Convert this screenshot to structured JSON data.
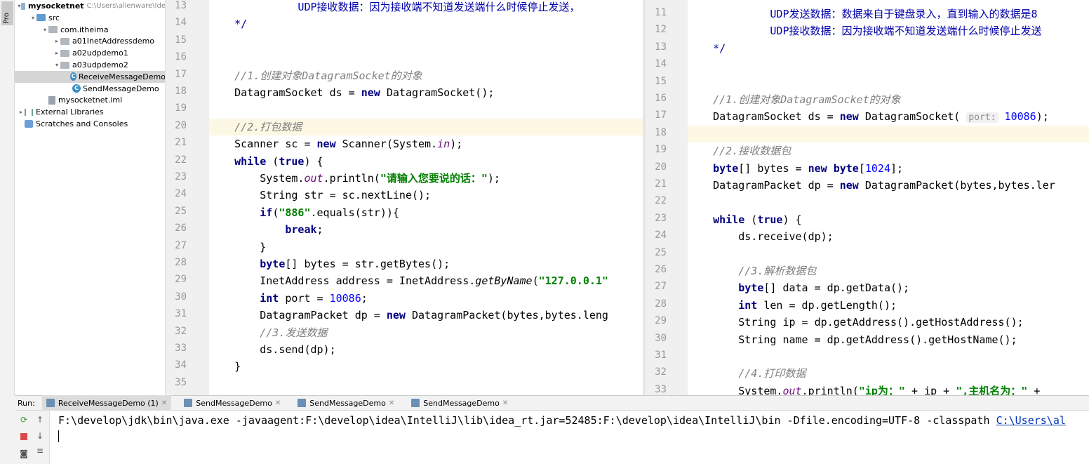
{
  "sidebar": {
    "project_tab": "Pro"
  },
  "project_tree": [
    {
      "label": "mysocketnet",
      "path": "C:\\Users\\alienware\\Ide",
      "type": "module",
      "depth": 0,
      "expanded": true
    },
    {
      "label": "src",
      "type": "src-folder",
      "depth": 1,
      "expanded": true
    },
    {
      "label": "com.itheima",
      "type": "package",
      "depth": 2,
      "expanded": true
    },
    {
      "label": "a01InetAddressdemo",
      "type": "package",
      "depth": 3,
      "expanded": false
    },
    {
      "label": "a02udpdemo1",
      "type": "package",
      "depth": 3,
      "expanded": false
    },
    {
      "label": "a03udpdemo2",
      "type": "package",
      "depth": 3,
      "expanded": true
    },
    {
      "label": "ReceiveMessageDemo",
      "type": "class",
      "depth": 4,
      "selected": true
    },
    {
      "label": "SendMessageDemo",
      "type": "class",
      "depth": 4
    },
    {
      "label": "mysocketnet.iml",
      "type": "iml",
      "depth": 2
    },
    {
      "label": "External Libraries",
      "type": "libs",
      "depth": 0,
      "expanded": false
    },
    {
      "label": "Scratches and Consoles",
      "type": "scratches",
      "depth": 0
    }
  ],
  "editor_left": {
    "lines": [
      {
        "n": "13",
        "code": "              UDP接收数据：因为接收端不知道发送端什么时候停止发送，",
        "style": "doc"
      },
      {
        "n": "14",
        "code": "    */",
        "style": "doc"
      },
      {
        "n": "15",
        "code": ""
      },
      {
        "n": "16",
        "code": ""
      },
      {
        "n": "17",
        "code": "    //1.创建对象DatagramSocket的对象",
        "style": "cm"
      },
      {
        "n": "18",
        "code": "    DatagramSocket ds = new DatagramSocket();"
      },
      {
        "n": "19",
        "code": ""
      },
      {
        "n": "20",
        "code": "    //2.打包数据",
        "style": "cm",
        "highlight": true
      },
      {
        "n": "21",
        "code": "    Scanner sc = new Scanner(System.in);"
      },
      {
        "n": "22",
        "code": "    while (true) {"
      },
      {
        "n": "23",
        "code": "        System.out.println(\"请输入您要说的话：\");"
      },
      {
        "n": "24",
        "code": "        String str = sc.nextLine();"
      },
      {
        "n": "25",
        "code": "        if(\"886\".equals(str)){"
      },
      {
        "n": "26",
        "code": "            break;"
      },
      {
        "n": "27",
        "code": "        }"
      },
      {
        "n": "28",
        "code": "        byte[] bytes = str.getBytes();"
      },
      {
        "n": "29",
        "code": "        InetAddress address = InetAddress.getByName(\"127.0.0.1\""
      },
      {
        "n": "30",
        "code": "        int port = 10086;"
      },
      {
        "n": "31",
        "code": "        DatagramPacket dp = new DatagramPacket(bytes,bytes.leng"
      },
      {
        "n": "32",
        "code": "        //3.发送数据",
        "style": "cm"
      },
      {
        "n": "33",
        "code": "        ds.send(dp);"
      },
      {
        "n": "34",
        "code": "    }"
      },
      {
        "n": "35",
        "code": ""
      }
    ]
  },
  "editor_right": {
    "lines": [
      {
        "n": "11",
        "code": "             UDP发送数据：数据来自于键盘录入，直到输入的数据是8",
        "style": "doc"
      },
      {
        "n": "12",
        "code": "             UDP接收数据：因为接收端不知道发送端什么时候停止发送",
        "style": "doc"
      },
      {
        "n": "13",
        "code": "    */",
        "style": "doc"
      },
      {
        "n": "14",
        "code": ""
      },
      {
        "n": "15",
        "code": ""
      },
      {
        "n": "16",
        "code": "    //1.创建对象DatagramSocket的对象",
        "style": "cm"
      },
      {
        "n": "17",
        "code": "    DatagramSocket ds = new DatagramSocket( port: 10086);"
      },
      {
        "n": "18",
        "code": "",
        "highlight": true
      },
      {
        "n": "19",
        "code": "    //2.接收数据包",
        "style": "cm"
      },
      {
        "n": "20",
        "code": "    byte[] bytes = new byte[1024];"
      },
      {
        "n": "21",
        "code": "    DatagramPacket dp = new DatagramPacket(bytes,bytes.ler"
      },
      {
        "n": "22",
        "code": ""
      },
      {
        "n": "23",
        "code": "    while (true) {"
      },
      {
        "n": "24",
        "code": "        ds.receive(dp);"
      },
      {
        "n": "25",
        "code": ""
      },
      {
        "n": "26",
        "code": "        //3.解析数据包",
        "style": "cm"
      },
      {
        "n": "27",
        "code": "        byte[] data = dp.getData();"
      },
      {
        "n": "28",
        "code": "        int len = dp.getLength();"
      },
      {
        "n": "29",
        "code": "        String ip = dp.getAddress().getHostAddress();"
      },
      {
        "n": "30",
        "code": "        String name = dp.getAddress().getHostName();"
      },
      {
        "n": "31",
        "code": ""
      },
      {
        "n": "32",
        "code": "        //4.打印数据",
        "style": "cm"
      },
      {
        "n": "33",
        "code": "        System.out.println(\"ip为：\" + ip + \",主机名为：\" +"
      }
    ]
  },
  "run_panel": {
    "label": "Run:",
    "tabs": [
      {
        "label": "ReceiveMessageDemo (1)",
        "active": true
      },
      {
        "label": "SendMessageDemo"
      },
      {
        "label": "SendMessageDemo"
      },
      {
        "label": "SendMessageDemo"
      }
    ],
    "console_text": "F:\\develop\\jdk\\bin\\java.exe -javaagent:F:\\develop\\idea\\IntelliJ\\lib\\idea_rt.jar=52485:F:\\develop\\idea\\IntelliJ\\bin -Dfile.encoding=UTF-8 -classpath ",
    "console_link": "C:\\Users\\al"
  },
  "colors": {
    "keyword": "#000080",
    "string": "#008000",
    "comment": "#808080",
    "number": "#0000ff",
    "highlight_line": "#fcf8e4"
  }
}
